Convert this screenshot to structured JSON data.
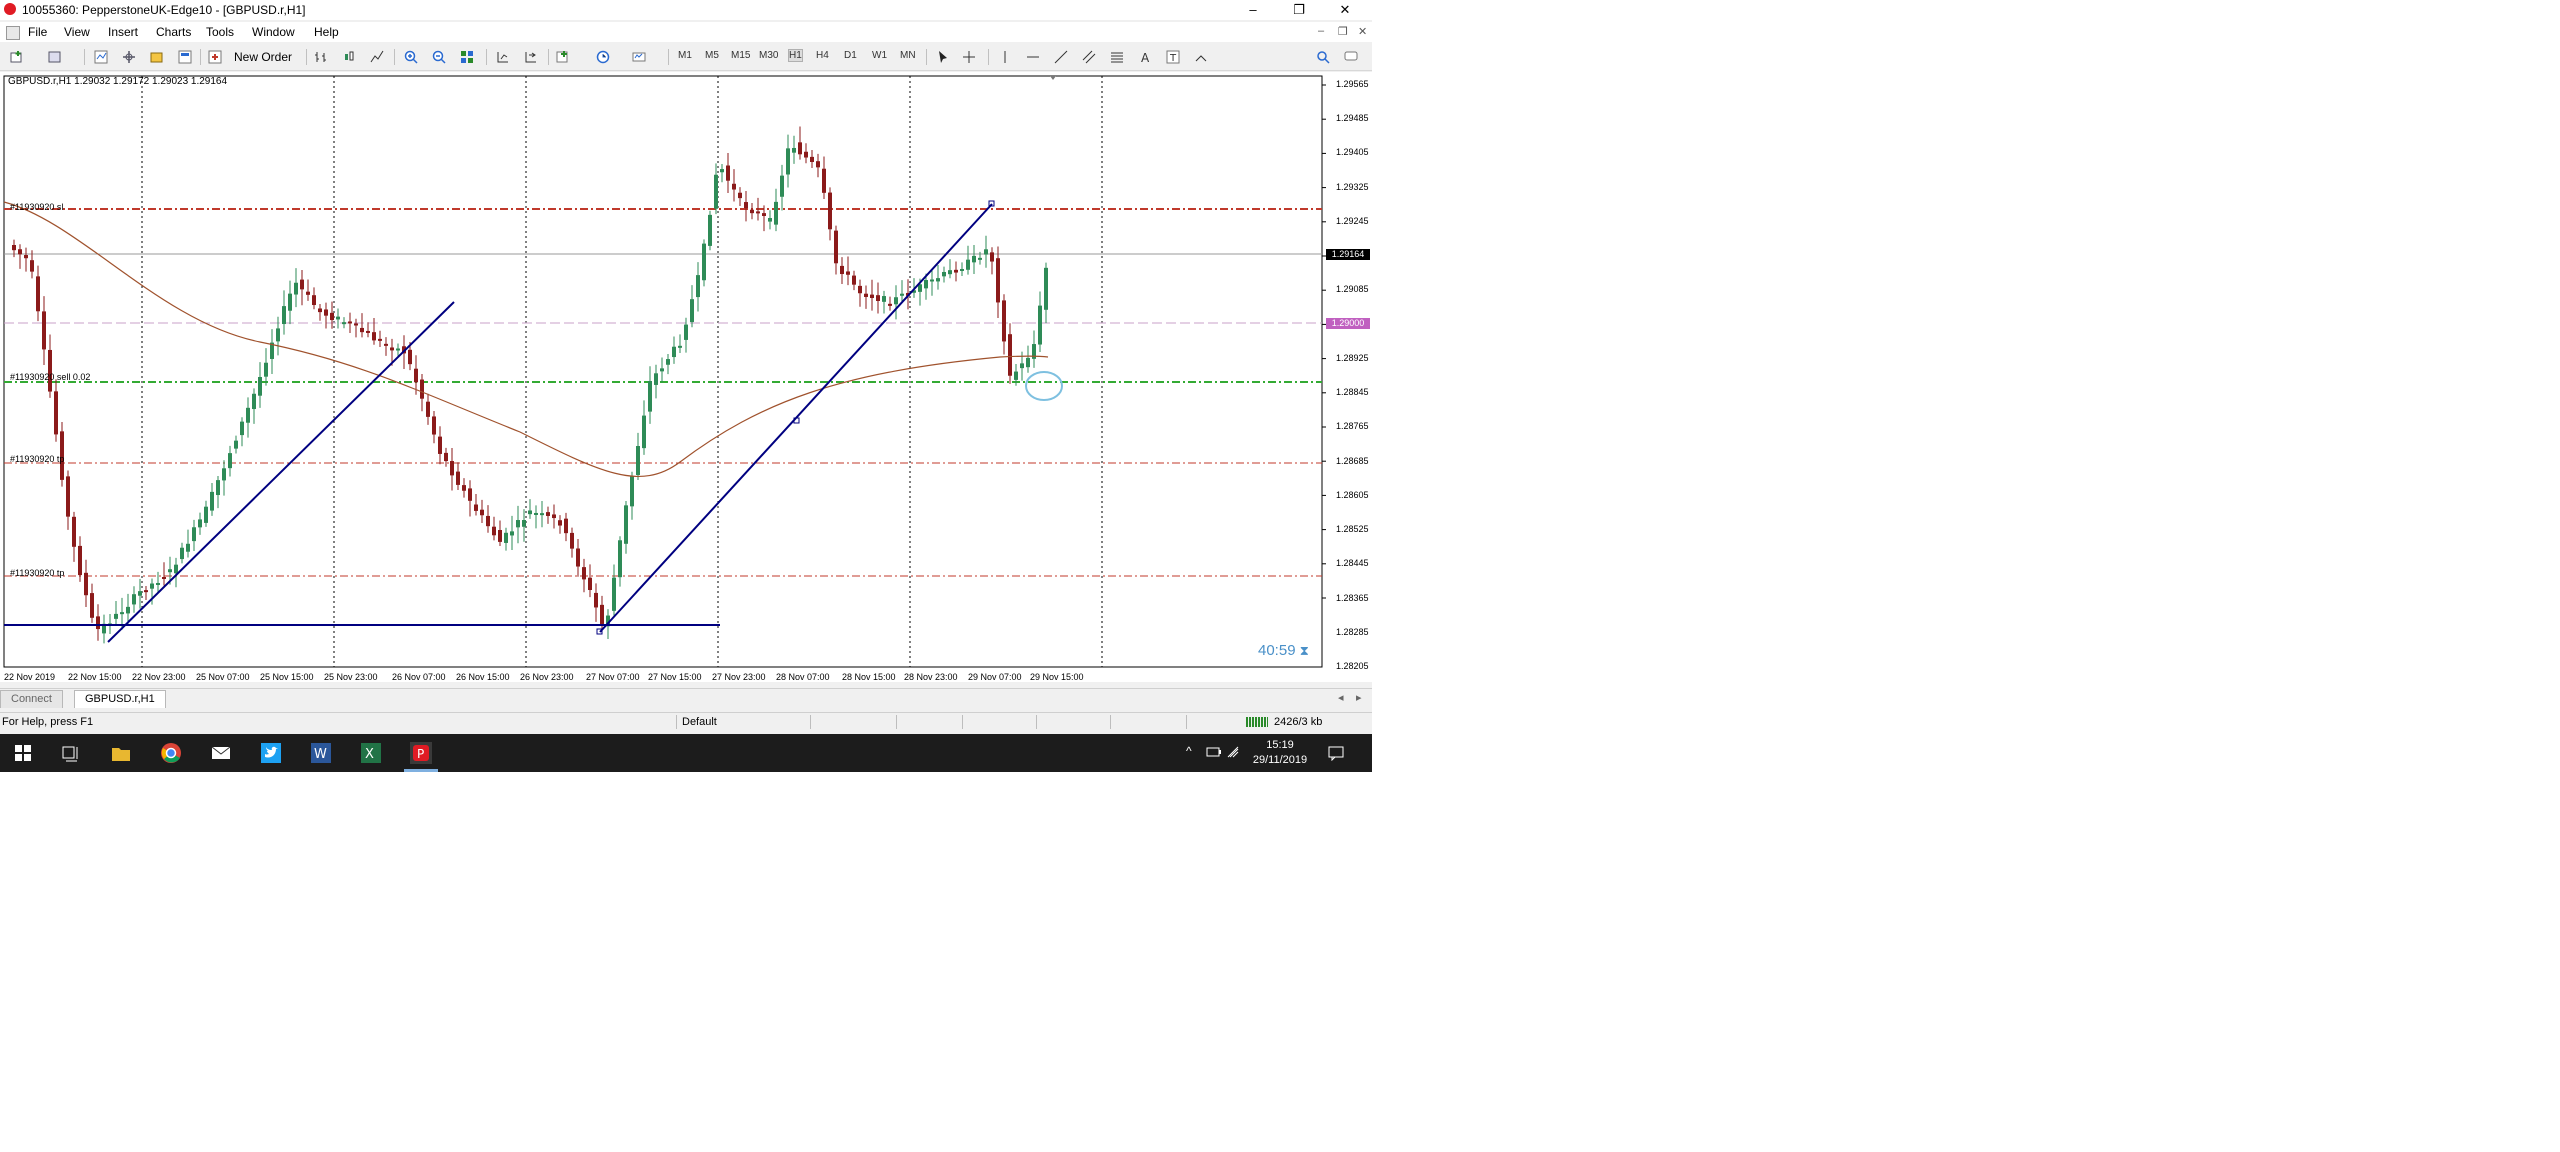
{
  "window": {
    "title": "10055360: PepperstoneUK-Edge10 - [GBPUSD.r,H1]",
    "controls": [
      "–",
      "❐",
      "✕"
    ],
    "mdi_controls": [
      "–",
      "❐",
      "✕"
    ]
  },
  "menu": [
    "File",
    "View",
    "Insert",
    "Charts",
    "Tools",
    "Window",
    "Help"
  ],
  "toolbar": {
    "new_order_label": "New Order",
    "timeframes": [
      "M1",
      "M5",
      "M15",
      "M30",
      "H1",
      "H4",
      "D1",
      "W1",
      "MN"
    ],
    "active_timeframe": "H1"
  },
  "chart": {
    "info": "GBPUSD.r,H1  1.29032 1.29172 1.29023 1.29164",
    "current_price_tag": "1.29164",
    "current_price_color": "#000000",
    "pending_price_tag": "1.29000",
    "pending_price_color": "#c060c0",
    "price_ticks": [
      "1.29565",
      "1.29485",
      "1.29405",
      "1.29325",
      "1.29245",
      "1.29085",
      "1.28925",
      "1.28845",
      "1.28765",
      "1.28685",
      "1.28605",
      "1.28525",
      "1.28445",
      "1.28365",
      "1.28285",
      "1.28205"
    ],
    "time_ticks": [
      "22 Nov 2019",
      "22 Nov 15:00",
      "22 Nov 23:00",
      "25 Nov 07:00",
      "25 Nov 15:00",
      "25 Nov 23:00",
      "26 Nov 07:00",
      "26 Nov 15:00",
      "26 Nov 23:00",
      "27 Nov 07:00",
      "27 Nov 15:00",
      "27 Nov 23:00",
      "28 Nov 07:00",
      "28 Nov 15:00",
      "28 Nov 23:00",
      "29 Nov 07:00",
      "29 Nov 15:00"
    ],
    "order_labels": {
      "sl": "#11930920 sl",
      "sell": "#11930920 sell 0.02",
      "tp1": "#11930920 tp",
      "tp2": "#11930920 tp"
    },
    "timer": "40:59",
    "colors": {
      "bull": "#2e8b57",
      "bear": "#8b1a1a",
      "trendline": "#000080",
      "ma": "#a0522d",
      "sl_line": "#c0392b",
      "entry_line": "#33aa33"
    }
  },
  "tabs": {
    "connect": "Connect",
    "chart_tab": "GBPUSD.r,H1"
  },
  "status": {
    "help": "For Help, press F1",
    "profile": "Default",
    "traffic": "2426/3 kb"
  },
  "taskbar": {
    "time": "15:19",
    "date": "29/11/2019"
  }
}
